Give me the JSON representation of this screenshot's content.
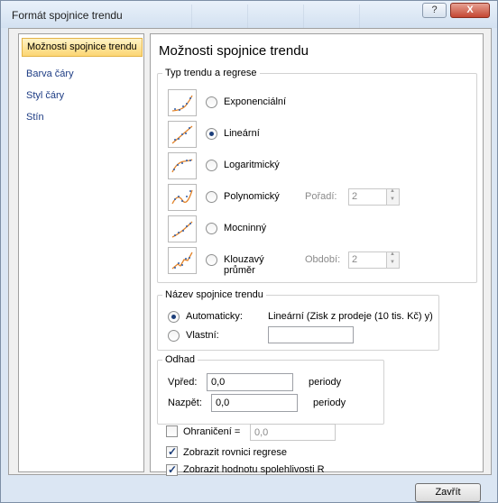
{
  "window": {
    "title": "Formát spojnice trendu",
    "help_label": "?",
    "close_label": "X"
  },
  "nav": {
    "items": [
      {
        "label": "Možnosti spojnice trendu",
        "selected": true
      },
      {
        "label": "Barva čáry",
        "selected": false
      },
      {
        "label": "Styl čáry",
        "selected": false
      },
      {
        "label": "Stín",
        "selected": false
      }
    ]
  },
  "pane": {
    "title": "Možnosti spojnice trendu",
    "trend_group": {
      "title": "Typ trendu a regrese",
      "options": [
        {
          "label": "Exponenciální",
          "icon": "exponential-chart-icon",
          "checked": false
        },
        {
          "label": "Lineární",
          "icon": "linear-chart-icon",
          "checked": true
        },
        {
          "label": "Logaritmický",
          "icon": "logarithmic-chart-icon",
          "checked": false
        },
        {
          "label": "Polynomický",
          "icon": "polynomial-chart-icon",
          "checked": false
        },
        {
          "label": "Mocninný",
          "icon": "power-chart-icon",
          "checked": false
        },
        {
          "label": "Klouzavý průměr",
          "icon": "moving-average-chart-icon",
          "checked": false
        }
      ],
      "order_label": "Pořadí:",
      "order_value": "2",
      "period_label": "Období:",
      "period_value": "2"
    },
    "name_group": {
      "title": "Název spojnice trendu",
      "auto_label": "Automaticky:",
      "auto_value": "Lineární (Zisk z prodeje (10 tis. Kč) y)",
      "custom_label": "Vlastní:",
      "custom_value": ""
    },
    "forecast_group": {
      "title": "Odhad",
      "forward_label": "Vpřed:",
      "forward_value": "0,0",
      "backward_label": "Nazpět:",
      "backward_value": "0,0",
      "unit": "periody"
    },
    "intercept_label": "Ohraničení =",
    "intercept_value": "0,0",
    "show_equation_label": "Zobrazit rovnici regrese",
    "show_rsquared_label": "Zobrazit hodnotu spolehlivosti R"
  },
  "footer": {
    "close_button": "Zavřít"
  },
  "colors": {
    "selected_nav": "#fcd673",
    "link_text": "#1d3c84",
    "trend_line": "#e2842b",
    "points": "#2f5da8"
  }
}
